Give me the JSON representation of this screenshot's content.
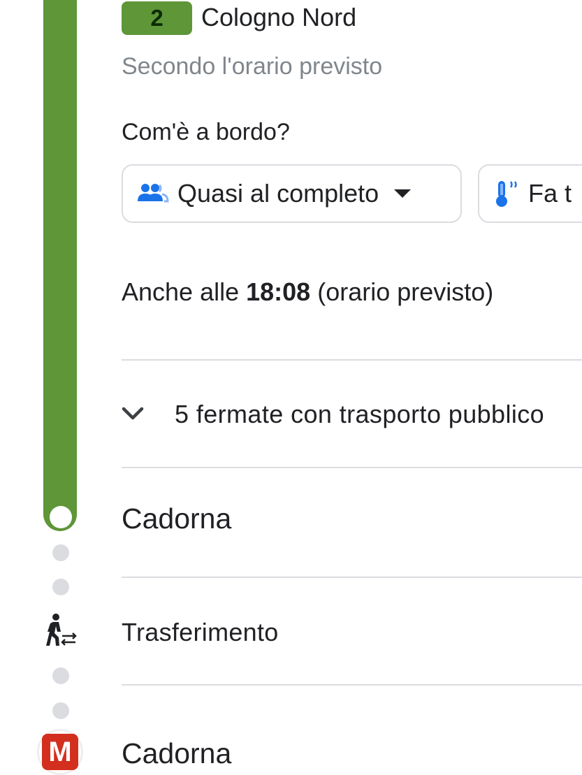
{
  "colors": {
    "line": "#5e9638",
    "badge": "#5e9638",
    "accent_blue": "#1a73e8",
    "metro_red": "#d32f1f"
  },
  "trip": {
    "line_number": "2",
    "destination": "Cologno Nord",
    "schedule_note": "Secondo l'orario previsto"
  },
  "onboard": {
    "question": "Com'è a bordo?",
    "crowd_chip": {
      "icon": "people-icon",
      "label": "Quasi al completo"
    },
    "temp_chip": {
      "icon": "thermometer-icon",
      "label": "Fa t"
    }
  },
  "also_at": {
    "prefix": "Anche alle ",
    "time": "18:08",
    "suffix": " (orario previsto)"
  },
  "stops_toggle": {
    "icon": "chevron-down-icon",
    "label": "5 fermate con trasporto pubblico"
  },
  "arrival_stop": "Cadorna",
  "transfer": {
    "icon": "walk-transfer-icon",
    "label": "Trasferimento"
  },
  "next_stop": {
    "icon": "metro-logo-icon",
    "logo_letter": "M",
    "label": "Cadorna"
  }
}
